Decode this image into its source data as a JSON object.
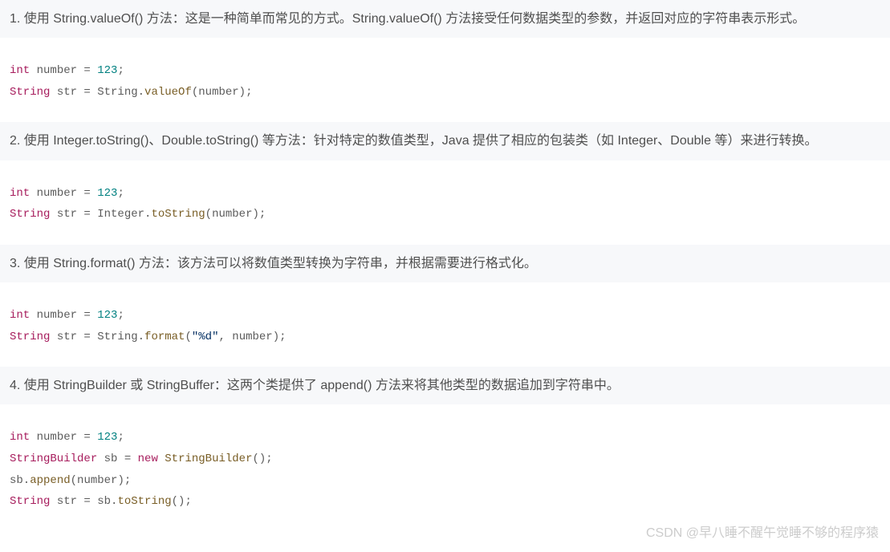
{
  "sections": [
    {
      "heading": "1. 使用 String.valueOf() 方法：这是一种简单而常见的方式。String.valueOf() 方法接受任何数据类型的参数，并返回对应的字符串表示形式。",
      "code": {
        "line1_type": "int",
        "line1_rest": " number = ",
        "line1_num": "123",
        "line1_semi": ";",
        "line2_type": "String",
        "line2_rest1": " str = String.",
        "line2_method": "valueOf",
        "line2_rest2": "(number);"
      }
    },
    {
      "heading": "2. 使用 Integer.toString()、Double.toString() 等方法：针对特定的数值类型，Java 提供了相应的包装类（如 Integer、Double 等）来进行转换。",
      "code": {
        "line1_type": "int",
        "line1_rest": " number = ",
        "line1_num": "123",
        "line1_semi": ";",
        "line2_type": "String",
        "line2_rest1": " str = Integer.",
        "line2_method": "toString",
        "line2_rest2": "(number);"
      }
    },
    {
      "heading": "3. 使用 String.format() 方法：该方法可以将数值类型转换为字符串，并根据需要进行格式化。",
      "code": {
        "line1_type": "int",
        "line1_rest": " number = ",
        "line1_num": "123",
        "line1_semi": ";",
        "line2_type": "String",
        "line2_rest1": " str = String.",
        "line2_method": "format",
        "line2_rest2a": "(",
        "line2_str": "\"%d\"",
        "line2_rest2b": ", number);"
      }
    },
    {
      "heading": "4. 使用 StringBuilder 或 StringBuffer：这两个类提供了 append() 方法来将其他类型的数据追加到字符串中。",
      "code": {
        "line1_type": "int",
        "line1_rest": " number = ",
        "line1_num": "123",
        "line1_semi": ";",
        "line2_type1": "StringBuilder",
        "line2_mid": " sb = ",
        "line2_new": "new",
        "line2_sp": " ",
        "line2_type2": "StringBuilder",
        "line2_end": "();",
        "line3_a": "sb.",
        "line3_method": "append",
        "line3_b": "(number);",
        "line4_type": "String",
        "line4_mid": " str = sb.",
        "line4_method": "toString",
        "line4_end": "();"
      }
    }
  ],
  "watermark": "CSDN @早八睡不醒午觉睡不够的程序猿"
}
